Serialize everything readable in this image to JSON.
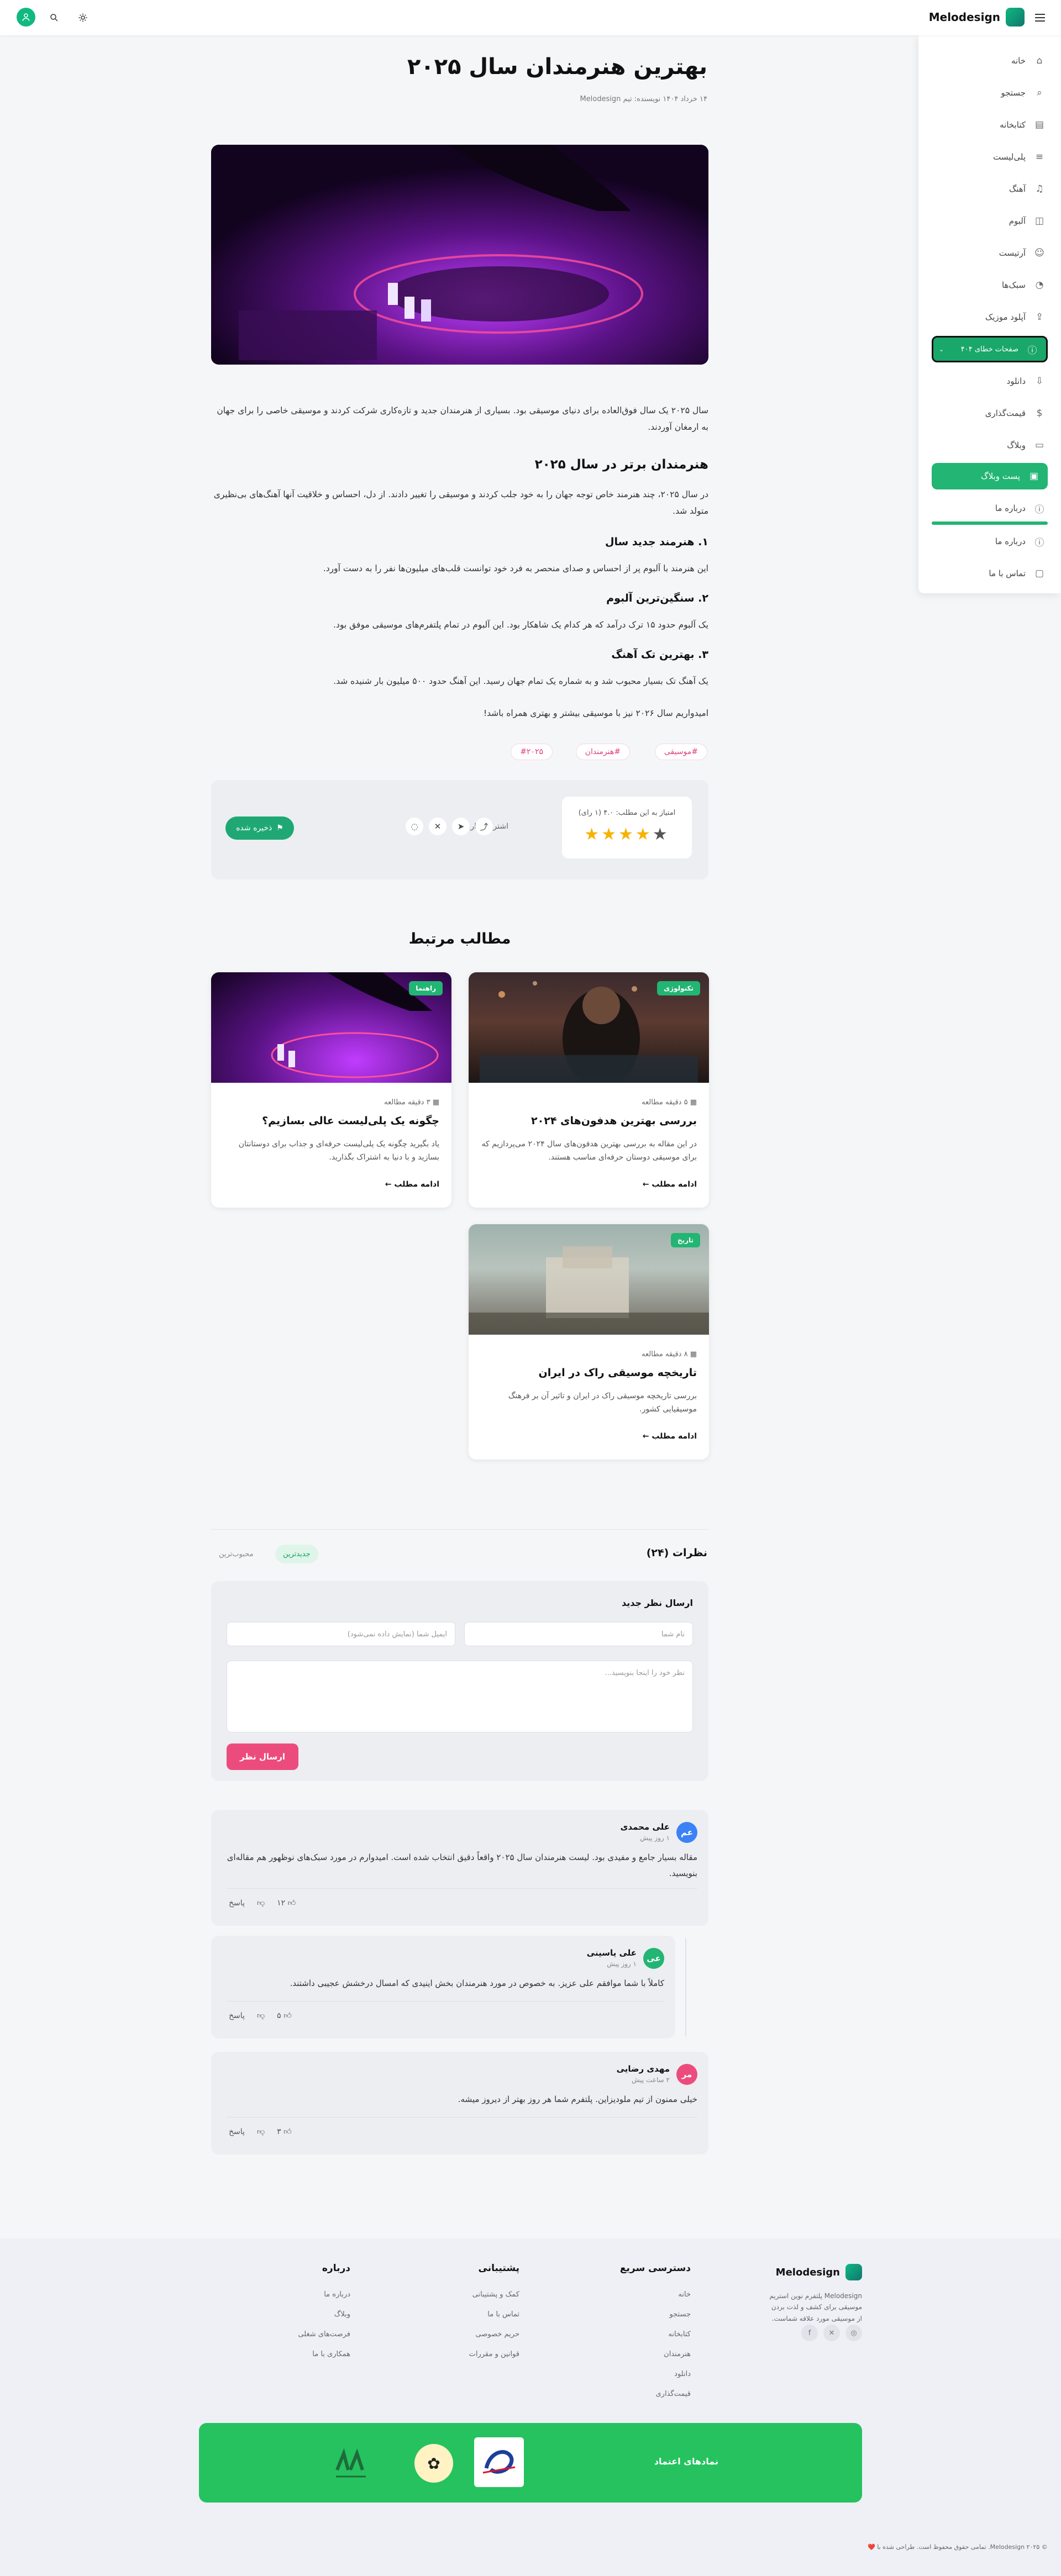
{
  "header": {
    "logo": "Melodesign",
    "menu_icon": "hamburger-icon",
    "search_icon": "search-icon",
    "theme_icon": "sun-icon",
    "user_icon": "user-icon"
  },
  "sidebar": {
    "items": [
      {
        "label": "خانه",
        "icon": "home-icon"
      },
      {
        "label": "جستجو",
        "icon": "search-icon"
      },
      {
        "label": "کتابخانه",
        "icon": "library-icon"
      },
      {
        "label": "پلی‌لیست",
        "icon": "playlist-icon"
      },
      {
        "label": "آهنگ",
        "icon": "music-note-icon"
      },
      {
        "label": "آلبوم",
        "icon": "album-icon"
      },
      {
        "label": "آرتیست",
        "icon": "user-icon"
      },
      {
        "label": "سبک‌ها",
        "icon": "genre-icon"
      },
      {
        "label": "آپلود موزیک",
        "icon": "upload-icon"
      },
      {
        "label": "صفحات خطای ۴۰۴",
        "icon": "error-icon"
      },
      {
        "label": "دانلود",
        "icon": "download-icon"
      },
      {
        "label": "قیمت‌گذاری",
        "icon": "dollar-icon"
      },
      {
        "label": "وبلاگ",
        "icon": "blog-icon"
      },
      {
        "label": "پست وبلاگ",
        "icon": "post-icon"
      },
      {
        "label": "درباره ما",
        "icon": "info-icon"
      },
      {
        "label": "درباره ما",
        "icon": "info-icon"
      },
      {
        "label": "تماس با ما",
        "icon": "chat-icon"
      }
    ]
  },
  "article": {
    "title": "بهترین هنرمندان سال ۲۰۲۵",
    "meta": "۱۴ خرداد ۱۴۰۴  نویسنده: تیم Melodesign",
    "intro": "سال ۲۰۲۵ یک سال فوق‌العاده برای دنیای موسیقی بود. بسیاری از هنرمندان جدید و تازه‌کاری شرکت کردند و موسیقی خاصی را برای جهان به ارمغان آوردند.",
    "h2": "هنرمندان برتر در سال ۲۰۲۵",
    "p2": "در سال ۲۰۲۵، چند هنرمند خاص توجه جهان را به خود جلب کردند و موسیقی را تغییر دادند. از دل، احساس و خلاقیت آنها آهنگ‌های بی‌نظیری متولد شد.",
    "h3a": "۱. هنرمند جدید سال",
    "p3a": "این هنرمند با آلبوم پر از احساس و صدای منحصر به فرد خود توانست قلب‌های میلیون‌ها نفر را به دست آورد.",
    "h3b": "۲. سنگین‌ترین آلبوم",
    "p3b": "یک آلبوم حدود ۱۵ ترک درآمد که هر کدام یک شاهکار بود. این آلبوم در تمام پلتفرم‌های موسیقی موفق بود.",
    "h3c": "۳. بهترین تک آهنگ",
    "p3c": "یک آهنگ تک بسیار محبوب شد و به شماره یک تمام جهان رسید. این آهنگ حدود ۵۰۰ میلیون بار شنیده شد.",
    "closing": "امیدواریم سال ۲۰۲۶ نیز با موسیقی بیشتر و بهتری همراه باشد!",
    "tags": [
      "#موسیقی",
      "#هنرمندان",
      "#۲۰۲۵"
    ]
  },
  "share": {
    "rating_label": "امتیاز به این مطلب: ۴.۰ (۱ رای)",
    "stars": 4,
    "stars_max": 5,
    "share_label": "اشتراک‌گذاری:",
    "save_label": "ذخیره شده"
  },
  "related": {
    "title": "مطالب مرتبط",
    "read_more": "ادامه مطلب",
    "cards": [
      {
        "badge": "تکنولوژی",
        "read_time": "۵ دقیقه مطالعه",
        "title": "بررسی بهترین هدفون‌های ۲۰۲۴",
        "excerpt": "در این مقاله به بررسی بهترین هدفون‌های سال ۲۰۲۴ می‌پردازیم که برای موسیقی دوستان حرفه‌ای مناسب هستند."
      },
      {
        "badge": "راهنما",
        "read_time": "۳ دقیقه مطالعه",
        "title": "چگونه یک پلی‌لیست عالی بسازیم؟",
        "excerpt": "یاد بگیرید چگونه یک پلی‌لیست حرفه‌ای و جذاب برای دوستانتان بسازید و با دنیا به اشتراک بگذارید."
      },
      {
        "badge": "تاریخ",
        "read_time": "۸ دقیقه مطالعه",
        "title": "تاریخچه موسیقی راک در ایران",
        "excerpt": "بررسی تاریخچه موسیقی راک در ایران و تاثیر آن بر فرهنگ موسیقیایی کشور."
      }
    ]
  },
  "comments": {
    "title": "نظرات (۲۴)",
    "sort_newest": "جدیدترین",
    "sort_popular": "محبوب‌ترین",
    "form": {
      "title": "ارسال نظر جدید",
      "name_placeholder": "نام شما",
      "email_placeholder": "ایمیل شما (نمایش داده نمی‌شود)",
      "text_placeholder": "نظر خود را اینجا بنویسید...",
      "submit": "ارسال نظر"
    },
    "reply_label": "پاسخ",
    "list": [
      {
        "initial": "عم",
        "name": "علی محمدی",
        "date": "۱ روز پیش",
        "text": "مقاله بسیار جامع و مفیدی بود. لیست هنرمندان سال ۲۰۲۵ واقعاً دقیق انتخاب شده است. امیدوارم در مورد سبک‌های نوظهور هم مقاله‌ای بنویسید.",
        "likes": "۱۲",
        "color": "#3b82f6"
      },
      {
        "initial": "عی",
        "name": "علی یاسینی",
        "date": "۱ روز پیش",
        "text": "کاملاً با شما موافقم علی عزیز. به خصوص در مورد هنرمندان بخش اینیدی که امسال درخشش عجیبی داشتند.",
        "likes": "۵",
        "color": "#22b573"
      },
      {
        "initial": "مر",
        "name": "مهدی رضایی",
        "date": "۲ ساعت پیش",
        "text": "خیلی ممنون از تیم ملودیزاین. پلتفرم شما هر روز بهتر از دیروز میشه.",
        "likes": "۳",
        "color": "#ec4c7d"
      }
    ]
  },
  "footer": {
    "brand": "Melodesign",
    "about": "Melodesign پلتفرم نوین استریم موسیقی برای کشف و لذت بردن از موسیقی مورد علاقه شماست.",
    "quick_title": "دسترسی سریع",
    "quick_links": [
      "خانه",
      "جستجو",
      "کتابخانه",
      "هنرمندان",
      "دانلود",
      "قیمت‌گذاری"
    ],
    "support_title": "پشتیبانی",
    "support_links": [
      "کمک و پشتیبانی",
      "تماس با ما",
      "حریم خصوصی",
      "قوانین و مقررات"
    ],
    "about_title": "درباره",
    "about_links": [
      "درباره ما",
      "وبلاگ",
      "فرصت‌های شغلی",
      "همکاری با ما"
    ],
    "trust_title": "نمادهای اعتماد",
    "copyright": "© ۲۰۲۵ Melodesign. تمامی حقوق محفوظ است. طراحی شده با ❤️"
  },
  "colors": {
    "brand": "#22b573",
    "accent": "#ec4c7d",
    "star": "#f5b301"
  }
}
